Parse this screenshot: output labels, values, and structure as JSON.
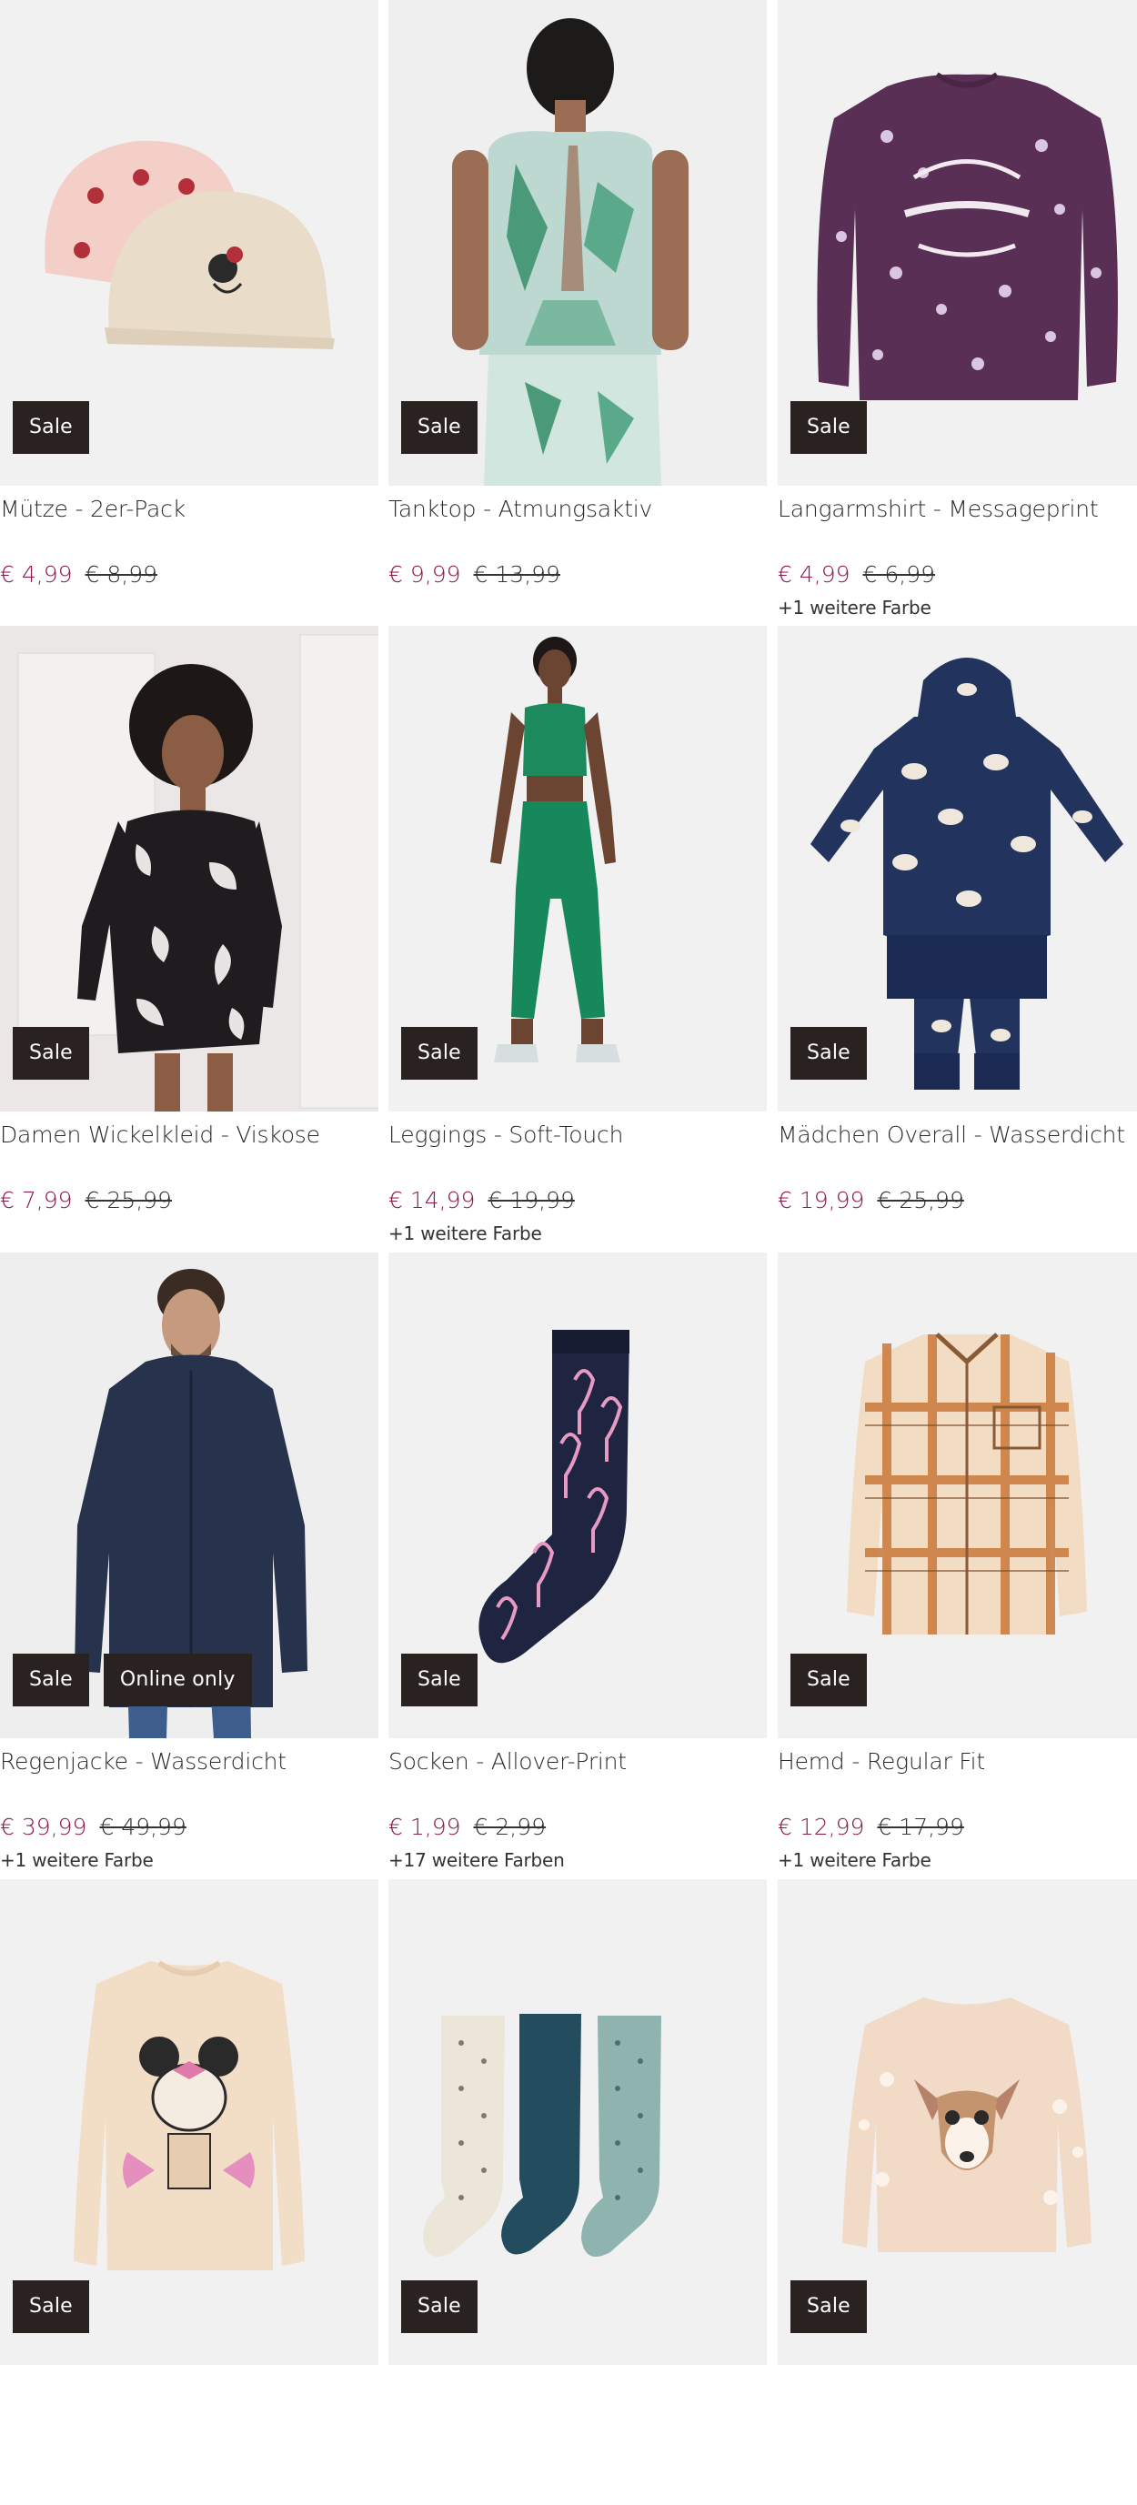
{
  "products": [
    {
      "name": "Mütze - 2er-Pack",
      "price": "€ 4,99",
      "old_price": "€ 8,99",
      "badges": [
        "Sale"
      ],
      "more": ""
    },
    {
      "name": "Tanktop - Atmungsaktiv",
      "price": "€ 9,99",
      "old_price": "€ 13,99",
      "badges": [
        "Sale"
      ],
      "more": ""
    },
    {
      "name": "Langarmshirt - Messageprint",
      "price": "€ 4,99",
      "old_price": "€ 6,99",
      "badges": [
        "Sale"
      ],
      "more": "+1 weitere Farbe"
    },
    {
      "name": "Damen Wickelkleid - Viskose",
      "price": "€ 7,99",
      "old_price": "€ 25,99",
      "badges": [
        "Sale"
      ],
      "more": ""
    },
    {
      "name": "Leggings - Soft-Touch",
      "price": "€ 14,99",
      "old_price": "€ 19,99",
      "badges": [
        "Sale"
      ],
      "more": "+1 weitere Farbe"
    },
    {
      "name": "Mädchen Overall - Wasserdicht",
      "price": "€ 19,99",
      "old_price": "€ 25,99",
      "badges": [
        "Sale"
      ],
      "more": ""
    },
    {
      "name": "Regenjacke - Wasserdicht",
      "price": "€ 39,99",
      "old_price": "€ 49,99",
      "badges": [
        "Sale",
        "Online only"
      ],
      "more": "+1 weitere Farbe"
    },
    {
      "name": "Socken - Allover-Print",
      "price": "€ 1,99",
      "old_price": "€ 2,99",
      "badges": [
        "Sale"
      ],
      "more": "+17 weitere Farben"
    },
    {
      "name": "Hemd - Regular Fit",
      "price": "€ 12,99",
      "old_price": "€ 17,99",
      "badges": [
        "Sale"
      ],
      "more": "+1 weitere Farbe"
    },
    {
      "name": "",
      "price": "",
      "old_price": "",
      "badges": [
        "Sale"
      ],
      "more": ""
    },
    {
      "name": "",
      "price": "",
      "old_price": "",
      "badges": [
        "Sale"
      ],
      "more": ""
    },
    {
      "name": "",
      "price": "",
      "old_price": "",
      "badges": [
        "Sale"
      ],
      "more": ""
    }
  ],
  "colors": {
    "sale_price": "#8b1a4a",
    "badge_bg": "#2a2220",
    "image_bg": "#f1f1f1"
  },
  "image_subjects": [
    "beanie-pair-image",
    "tanktop-model-image",
    "longsleeve-shirt-image",
    "wrap-dress-model-image",
    "leggings-model-image",
    "kids-overall-image",
    "rain-jacket-model-image",
    "flamingo-sock-image",
    "plaid-shirt-image",
    "minnie-longsleeve-image",
    "sock-set-image",
    "deer-sweater-image"
  ]
}
